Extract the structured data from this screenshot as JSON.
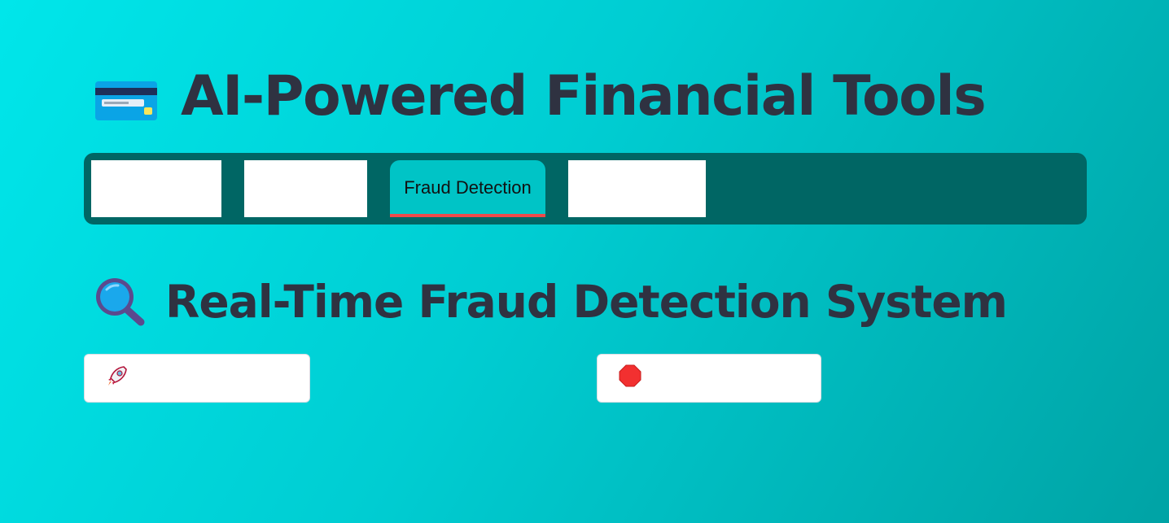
{
  "header": {
    "icon": "credit-card-icon",
    "title": "AI-Powered Financial Tools"
  },
  "tabs": [
    {
      "label": "",
      "active": false
    },
    {
      "label": "",
      "active": false
    },
    {
      "label": "Fraud Detection",
      "active": true
    },
    {
      "label": "",
      "active": false
    }
  ],
  "section": {
    "icon": "magnifying-glass-icon",
    "title": "Real-Time Fraud Detection System"
  },
  "buttons": {
    "start": {
      "icon": "rocket-icon",
      "label": ""
    },
    "stop": {
      "icon": "stop-sign-icon",
      "label": ""
    }
  },
  "colors": {
    "tabbar_bg": "#006664",
    "active_tab_bg": "#00c4c6",
    "active_tab_underline": "#ef4a4a",
    "heading_text": "#2f3241"
  }
}
